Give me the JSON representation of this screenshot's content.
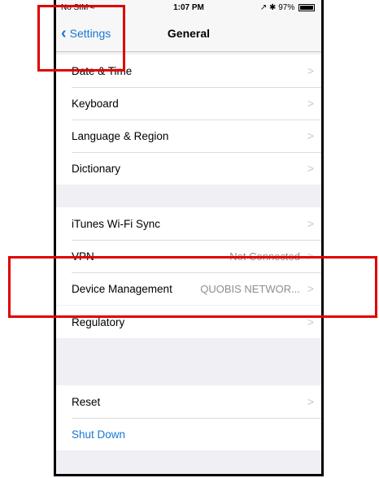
{
  "status_bar": {
    "carrier": "No SIM",
    "time": "1:07 PM",
    "battery": "97%"
  },
  "nav": {
    "back_label": "Settings",
    "title": "General"
  },
  "groups": [
    {
      "rows": [
        {
          "label": "Date & Time",
          "value": "",
          "arrow": ">"
        },
        {
          "label": "Keyboard",
          "value": "",
          "arrow": ">"
        },
        {
          "label": "Language & Region",
          "value": "",
          "arrow": ">"
        },
        {
          "label": "Dictionary",
          "value": "",
          "arrow": ">"
        }
      ]
    },
    {
      "rows": [
        {
          "label": "iTunes Wi-Fi Sync",
          "value": "",
          "arrow": ">"
        },
        {
          "label": "VPN",
          "value": "Not Connected",
          "arrow": ">"
        },
        {
          "label": "Device Management",
          "value": "QUOBIS NETWOR...",
          "arrow": ">"
        }
      ]
    },
    {
      "rows": [
        {
          "label": "Regulatory",
          "value": "",
          "arrow": ">"
        }
      ]
    },
    {
      "rows": [
        {
          "label": "Reset",
          "value": "",
          "arrow": ">"
        },
        {
          "label": "Shut Down",
          "value": ""
        }
      ]
    }
  ],
  "colors": {
    "accent": "#1678d4",
    "highlight": "#e00000",
    "background": "#efeff4"
  }
}
